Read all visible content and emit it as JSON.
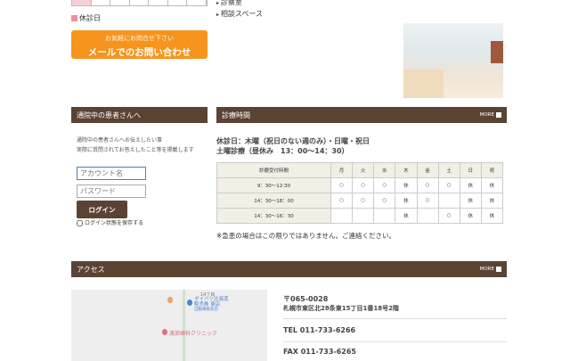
{
  "calendar": {
    "legend": "休診日"
  },
  "mail": {
    "sub": "お気軽にお問合せ下さい",
    "main": "メールでのお問い合わせ"
  },
  "links": [
    "診察室",
    "相談スペース"
  ],
  "patients": {
    "title": "通院中の患者さんへ",
    "text1": "通院中の患者さんへお伝えしたい事",
    "text2": "実際に質問されてお答えしたこと等を掲載します",
    "account_placeholder": "アカウント名",
    "password_placeholder": "パスワード",
    "login": "ログイン",
    "remember": "ログイン状態を保存する"
  },
  "hours": {
    "title": "診療時間",
    "more": "MORE",
    "closed": "休診日：木曜（祝日のない週のみ）・日曜・祝日",
    "saturday": "土曜診療（昼休み　13：00〜14：30）",
    "header": [
      "診療受付時間",
      "月",
      "火",
      "水",
      "木",
      "金",
      "土",
      "日",
      "祝"
    ],
    "rows": [
      [
        "9：30〜12:30",
        "○",
        "○",
        "○",
        "休",
        "○",
        "○",
        "休",
        "休"
      ],
      [
        "14：30〜18：00",
        "○",
        "○",
        "○",
        "休",
        "○",
        "",
        "休",
        "休"
      ],
      [
        "14：30〜16：30",
        "",
        "",
        "",
        "休",
        "",
        "○",
        "休",
        "休"
      ]
    ],
    "note": "※急患の場合はこの限りではありません。ご連絡ください。"
  },
  "access": {
    "title": "アクセス",
    "more": "MORE",
    "postal": "〒065-0028",
    "address": "札幌市東区北28条東15丁目1番18号2階",
    "tel": "TEL 011-733-6266",
    "fax": "FAX 011-733-6265",
    "map_labels": [
      "14丁目",
      "ダイハツ北海道",
      "販売株 東店",
      "自動車販売店",
      "渡部歯科クリニック"
    ]
  }
}
